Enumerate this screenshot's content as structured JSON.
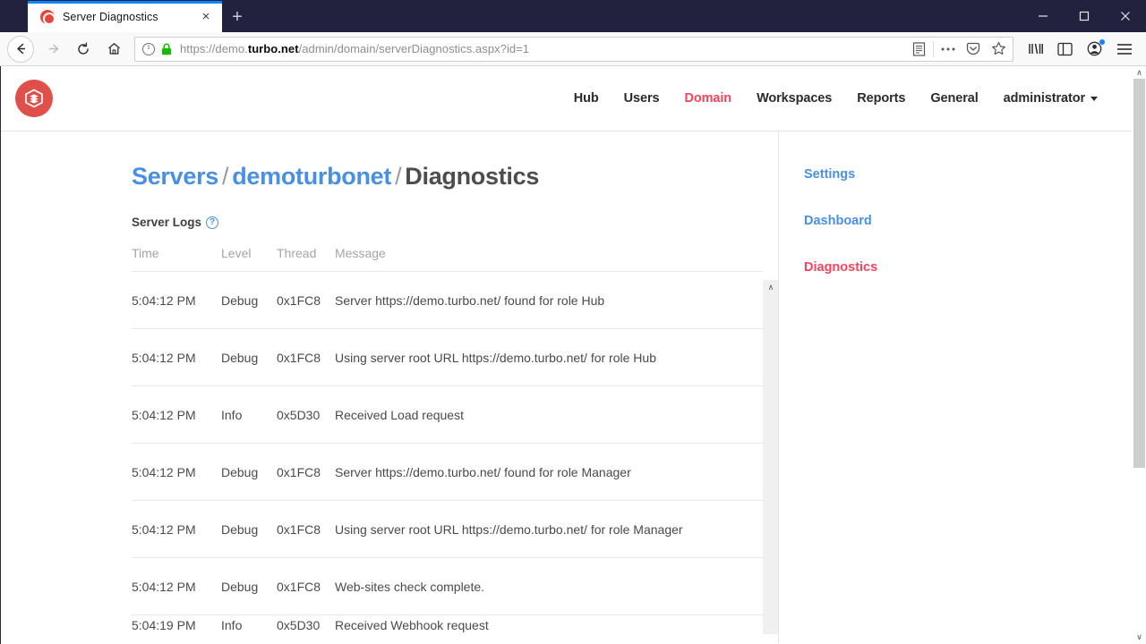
{
  "browser": {
    "tab": {
      "title": "Server Diagnostics",
      "favicon_name": "turbo-favicon",
      "close_label": "×"
    },
    "new_tab_label": "+",
    "window_controls": {
      "minimize": "–",
      "maximize": "□",
      "close": "✕"
    },
    "nav": {
      "back": "←",
      "forward": "→",
      "reload": "⟳",
      "home": "⌂"
    },
    "url": {
      "prefix": "https://demo.",
      "domain": "turbo.net",
      "path": "/admin/domain/serverDiagnostics.aspx?id=1",
      "full": "https://demo.turbo.net/admin/domain/serverDiagnostics.aspx?id=1"
    },
    "url_actions": [
      "reader-view-icon",
      "page-actions-icon",
      "pocket-icon",
      "bookmark-star-icon"
    ],
    "toolbar_right": [
      "library-icon",
      "sidebar-icon",
      "account-icon",
      "menu-icon"
    ]
  },
  "site": {
    "logo_name": "turbo-cube-logo",
    "nav": [
      {
        "label": "Hub",
        "active": false
      },
      {
        "label": "Users",
        "active": false
      },
      {
        "label": "Domain",
        "active": true
      },
      {
        "label": "Workspaces",
        "active": false
      },
      {
        "label": "Reports",
        "active": false
      },
      {
        "label": "General",
        "active": false
      }
    ],
    "user_menu": {
      "label": "administrator"
    },
    "accent_red": "#f8415a",
    "accent_blue": "#4a90e2"
  },
  "breadcrumb": {
    "root": "Servers",
    "sep1": "/",
    "middle": "demoturbonet",
    "sep2": "/",
    "current": "Diagnostics"
  },
  "section": {
    "title": "Server Logs",
    "help_glyph": "?"
  },
  "log_table": {
    "columns": [
      "Time",
      "Level",
      "Thread",
      "Message"
    ],
    "rows": [
      {
        "time": "5:04:12 PM",
        "level": "Debug",
        "thread": "0x1FC8",
        "message": "Server https://demo.turbo.net/ found for role Hub"
      },
      {
        "time": "5:04:12 PM",
        "level": "Debug",
        "thread": "0x1FC8",
        "message": "Using server root URL https://demo.turbo.net/ for role Hub"
      },
      {
        "time": "5:04:12 PM",
        "level": "Info",
        "thread": "0x5D30",
        "message": "Received Load request"
      },
      {
        "time": "5:04:12 PM",
        "level": "Debug",
        "thread": "0x1FC8",
        "message": "Server https://demo.turbo.net/ found for role Manager"
      },
      {
        "time": "5:04:12 PM",
        "level": "Debug",
        "thread": "0x1FC8",
        "message": "Using server root URL https://demo.turbo.net/ for role Manager"
      },
      {
        "time": "5:04:12 PM",
        "level": "Debug",
        "thread": "0x1FC8",
        "message": "Web-sites check complete."
      },
      {
        "time": "5:04:19 PM",
        "level": "Info",
        "thread": "0x5D30",
        "message": "Received Webhook request"
      }
    ]
  },
  "sidebar": {
    "links": [
      {
        "label": "Settings",
        "active": false
      },
      {
        "label": "Dashboard",
        "active": false
      },
      {
        "label": "Diagnostics",
        "active": true
      }
    ]
  },
  "scrollbars": {
    "log_up_arrow": "∧",
    "page_up_arrow": "∧",
    "page_down_arrow": "∨"
  }
}
